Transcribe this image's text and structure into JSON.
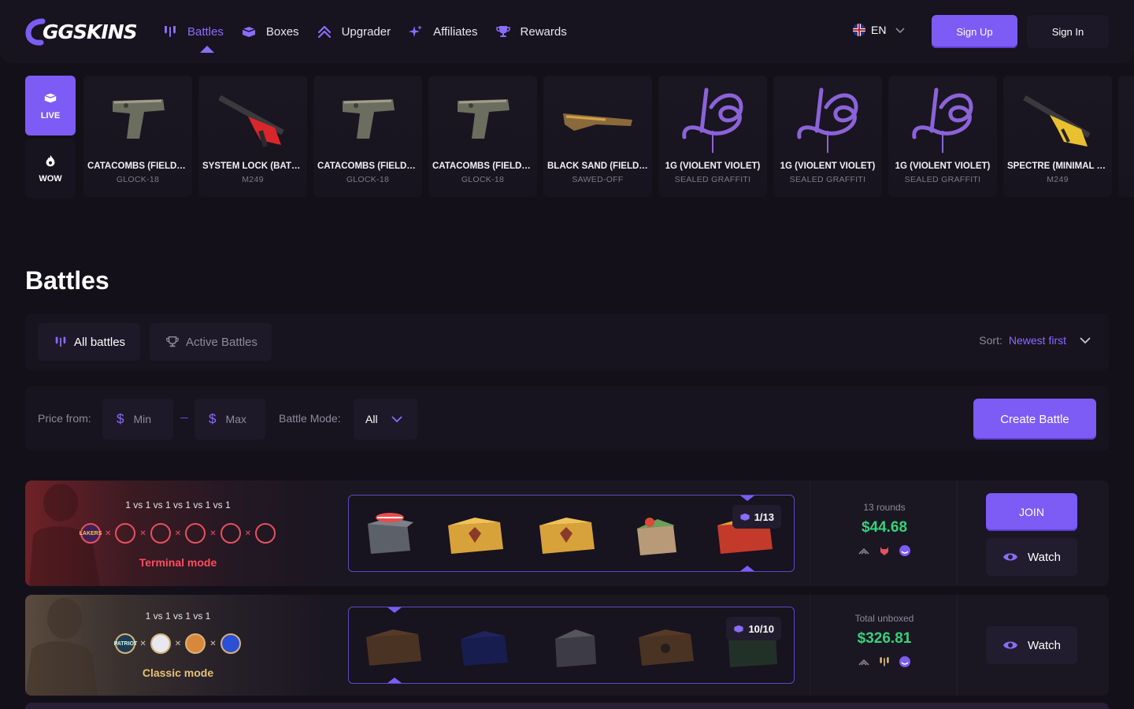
{
  "brand": {
    "logo_text": "GGSKINS"
  },
  "nav": [
    {
      "label": "Battles",
      "icon": "battles-icon",
      "active": true
    },
    {
      "label": "Boxes",
      "icon": "boxes-icon"
    },
    {
      "label": "Upgrader",
      "icon": "upgrader-icon"
    },
    {
      "label": "Affiliates",
      "icon": "affiliates-icon"
    },
    {
      "label": "Rewards",
      "icon": "rewards-icon"
    }
  ],
  "language": {
    "code": "EN",
    "flag": "uk-flag-icon"
  },
  "auth": {
    "signup_label": "Sign Up",
    "signin_label": "Sign In"
  },
  "live_tabs": {
    "live_label": "LIVE",
    "wow_label": "WOW"
  },
  "drops": [
    {
      "name": "CATACOMBS (FIELD-TESTED)",
      "type": "GLOCK-18",
      "art": "pistol"
    },
    {
      "name": "SYSTEM LOCK (BATTLE-SCARRED)",
      "type": "M249",
      "art": "rifle-red"
    },
    {
      "name": "CATACOMBS (FIELD-TESTED)",
      "type": "GLOCK-18",
      "art": "pistol"
    },
    {
      "name": "CATACOMBS (FIELD-TESTED)",
      "type": "GLOCK-18",
      "art": "pistol"
    },
    {
      "name": "BLACK SAND (FIELD-TESTED)",
      "type": "SAWED-OFF",
      "art": "shotgun"
    },
    {
      "name": "1G (VIOLENT VIOLET)",
      "type": "SEALED GRAFFITI",
      "art": "graffiti"
    },
    {
      "name": "1G (VIOLENT VIOLET)",
      "type": "SEALED GRAFFITI",
      "art": "graffiti"
    },
    {
      "name": "1G (VIOLENT VIOLET)",
      "type": "SEALED GRAFFITI",
      "art": "graffiti"
    },
    {
      "name": "SPECTRE (MINIMAL WEAR)",
      "type": "M249",
      "art": "rifle-yellow"
    },
    {
      "name": "O",
      "type": "",
      "art": "none"
    }
  ],
  "page": {
    "title": "Battles"
  },
  "filters": {
    "tab_all": "All battles",
    "tab_active": "Active Battles",
    "sort_label": "Sort:",
    "sort_value": "Newest first",
    "price_label": "Price from:",
    "min_placeholder": "Min",
    "max_placeholder": "Max",
    "currency_symbol": "$",
    "mode_label": "Battle Mode:",
    "mode_value": "All",
    "create_label": "Create Battle"
  },
  "battles": [
    {
      "vs_text": "1 vs 1 vs 1 vs 1 vs 1 vs 1",
      "mode": "Terminal mode",
      "mode_color": "#ff4d5e",
      "slots_total": 6,
      "slots_filled": 1,
      "rounds_badge": "1/13",
      "stats_label": "13 rounds",
      "price": "$44.68",
      "join_label": "JOIN",
      "watch_label": "Watch"
    },
    {
      "vs_text": "1 vs 1 vs 1 vs 1",
      "mode": "Classic mode",
      "mode_color": "#e8c07a",
      "slots_total": 4,
      "slots_filled": 4,
      "rounds_badge": "10/10",
      "stats_label": "Total unboxed",
      "price": "$326.81",
      "watch_label": "Watch"
    }
  ],
  "colors": {
    "accent": "#7c5cf5",
    "price_green": "#36d27a",
    "bg": "#131019"
  }
}
